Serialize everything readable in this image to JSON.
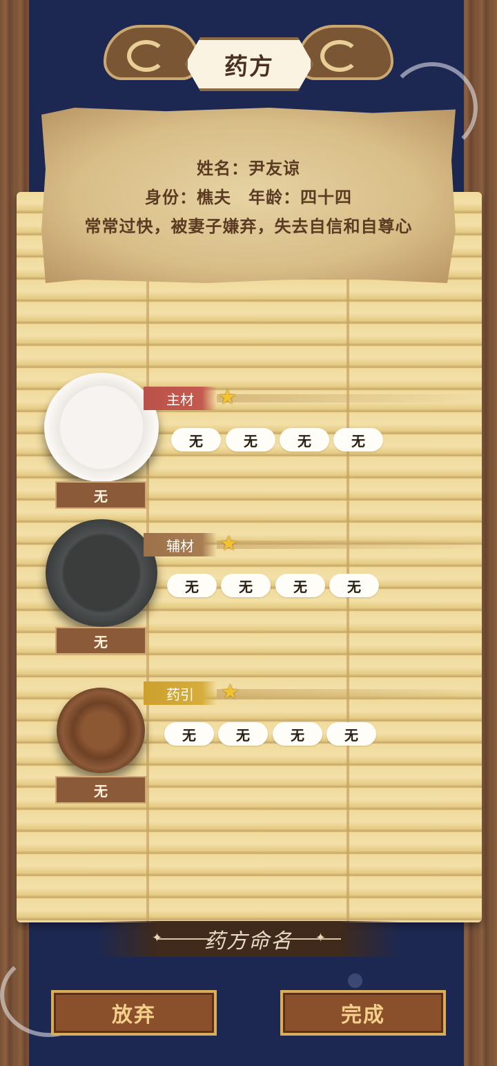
{
  "title": "药方",
  "patient": {
    "name_line": "姓名：尹友谅",
    "identity_line": "身份：樵夫　年龄：四十四",
    "condition_line": "常常过快，被妻子嫌弃，失去自信和自尊心"
  },
  "sections": [
    {
      "label": "主材",
      "tag": "无",
      "slots": [
        "无",
        "无",
        "无",
        "无"
      ],
      "color": "#c45a4f"
    },
    {
      "label": "辅材",
      "tag": "无",
      "slots": [
        "无",
        "无",
        "无",
        "无"
      ],
      "color": "#a97d52"
    },
    {
      "label": "药引",
      "tag": "无",
      "slots": [
        "无",
        "无",
        "无",
        "无"
      ],
      "color": "#d6ad3c"
    }
  ],
  "recipe_name_placeholder": "药方命名",
  "buttons": {
    "abandon": "放弃",
    "complete": "完成"
  },
  "icons": {
    "star": "star-icon",
    "cloud": "cloud-ornament-icon"
  }
}
